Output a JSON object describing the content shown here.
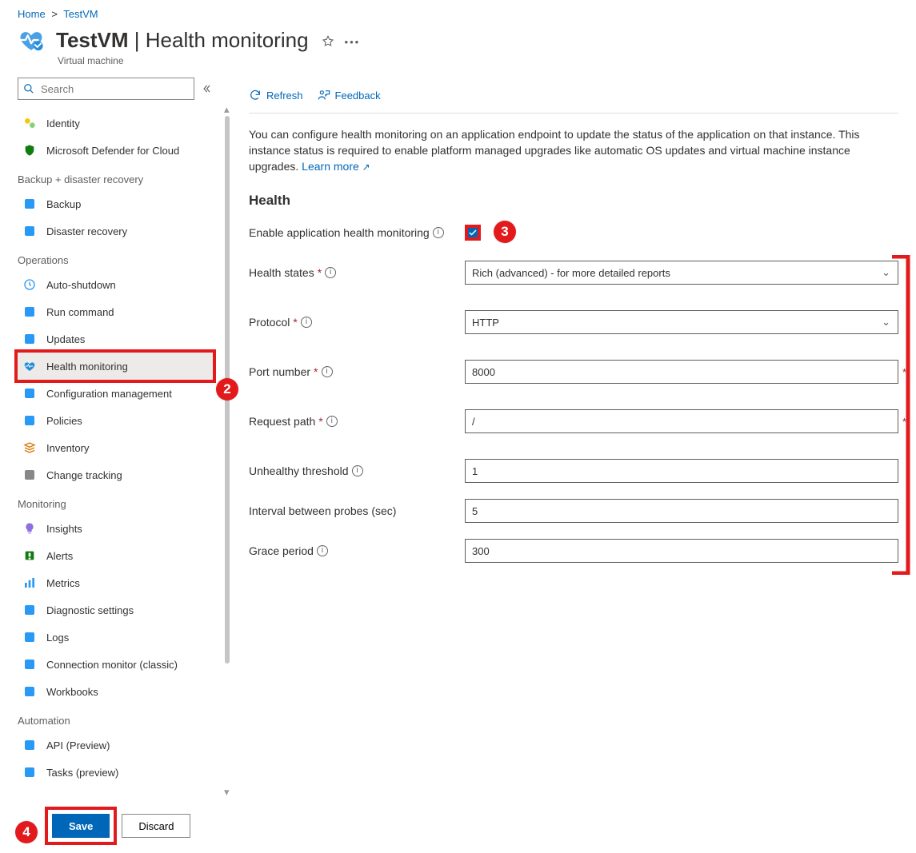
{
  "breadcrumb": {
    "home": "Home",
    "resource": "TestVM"
  },
  "title": {
    "name": "TestVM",
    "section": "Health monitoring",
    "subtitle": "Virtual machine"
  },
  "sidebar": {
    "search_placeholder": "Search",
    "items_top": [
      {
        "icon": "identity-icon",
        "label": "Identity",
        "color": "#f2c811"
      },
      {
        "icon": "defender-icon",
        "label": "Microsoft Defender for Cloud",
        "color": "#107c10"
      }
    ],
    "group_backup": "Backup + disaster recovery",
    "items_backup": [
      {
        "icon": "backup-icon",
        "label": "Backup",
        "color": "#2899f5"
      },
      {
        "icon": "dr-icon",
        "label": "Disaster recovery",
        "color": "#2899f5"
      }
    ],
    "group_ops": "Operations",
    "items_ops": [
      {
        "icon": "clock-icon",
        "label": "Auto-shutdown",
        "color": "#2899f5"
      },
      {
        "icon": "run-icon",
        "label": "Run command",
        "color": "#2899f5"
      },
      {
        "icon": "updates-icon",
        "label": "Updates",
        "color": "#2899f5"
      },
      {
        "icon": "health-icon",
        "label": "Health monitoring",
        "color": "#258dd9",
        "selected": true
      },
      {
        "icon": "config-icon",
        "label": "Configuration management",
        "color": "#2899f5"
      },
      {
        "icon": "policies-icon",
        "label": "Policies",
        "color": "#2899f5"
      },
      {
        "icon": "inventory-icon",
        "label": "Inventory",
        "color": "#db7500"
      },
      {
        "icon": "changes-icon",
        "label": "Change tracking",
        "color": "#888888"
      }
    ],
    "group_monitoring": "Monitoring",
    "items_monitoring": [
      {
        "icon": "insights-icon",
        "label": "Insights",
        "color": "#8f6fe0"
      },
      {
        "icon": "alerts-icon",
        "label": "Alerts",
        "color": "#107c10"
      },
      {
        "icon": "metrics-icon",
        "label": "Metrics",
        "color": "#2899f5"
      },
      {
        "icon": "diag-icon",
        "label": "Diagnostic settings",
        "color": "#2899f5"
      },
      {
        "icon": "logs-icon",
        "label": "Logs",
        "color": "#2899f5"
      },
      {
        "icon": "connmon-icon",
        "label": "Connection monitor (classic)",
        "color": "#2899f5"
      },
      {
        "icon": "workbooks-icon",
        "label": "Workbooks",
        "color": "#2899f5"
      }
    ],
    "group_automation": "Automation",
    "items_automation": [
      {
        "icon": "api-icon",
        "label": "API (Preview)",
        "color": "#2899f5"
      },
      {
        "icon": "tasks-icon",
        "label": "Tasks (preview)",
        "color": "#2899f5"
      }
    ]
  },
  "toolbar": {
    "refresh": "Refresh",
    "feedback": "Feedback"
  },
  "content": {
    "description": "You can configure health monitoring on an application endpoint to update the status of the application on that instance. This instance status is required to enable platform managed upgrades like automatic OS updates and virtual machine instance upgrades. ",
    "learn_more": "Learn more",
    "section_title": "Health",
    "enable_label": "Enable application health monitoring",
    "enable_checked": true,
    "fields": {
      "health_states_label": "Health states",
      "health_states_value": "Rich (advanced) - for more detailed reports",
      "protocol_label": "Protocol",
      "protocol_value": "HTTP",
      "port_label": "Port number",
      "port_value": "8000",
      "path_label": "Request path",
      "path_value": "/",
      "unhealthy_label": "Unhealthy threshold",
      "unhealthy_value": "1",
      "interval_label": "Interval between probes (sec)",
      "interval_value": "5",
      "grace_label": "Grace period",
      "grace_value": "300"
    }
  },
  "footer": {
    "save": "Save",
    "discard": "Discard"
  },
  "callouts": {
    "c2": "2",
    "c3": "3",
    "c4": "4"
  }
}
